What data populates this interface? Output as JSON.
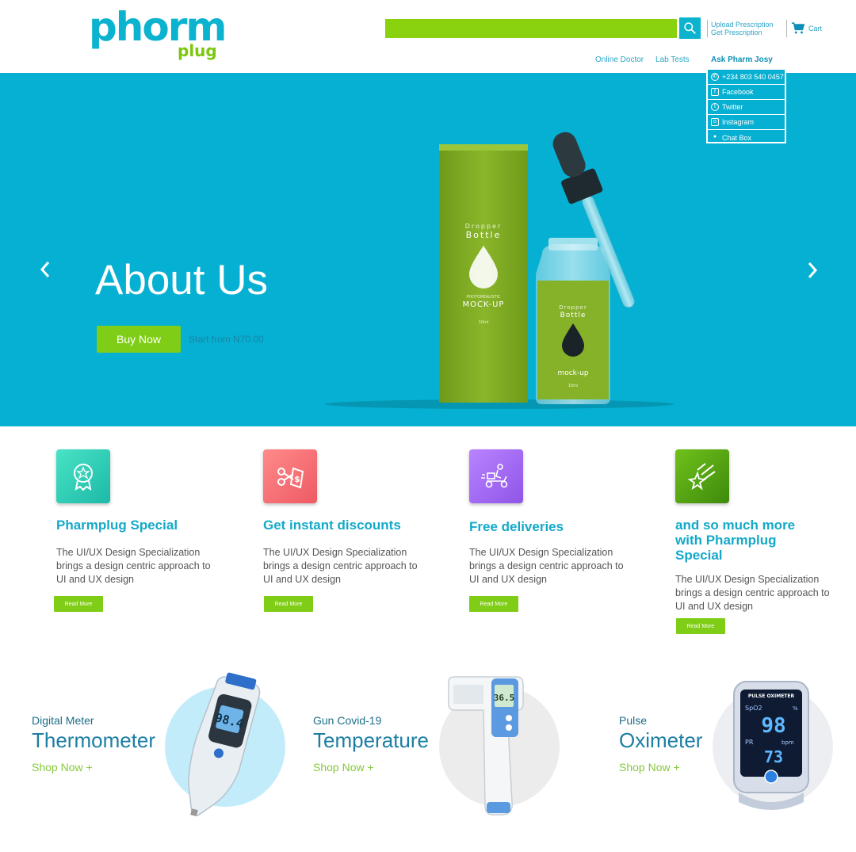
{
  "header": {
    "logo_main": "phorm",
    "logo_sub": "plug",
    "search_placeholder": "",
    "upload_prescription": "Upload Prescription",
    "get_prescription": "Get Prescription",
    "cart_label": "Cart",
    "nav": {
      "online_doctor": "Online Doctor",
      "lab_tests": "Lab Tests",
      "ask": "Ask Pharm Josy"
    }
  },
  "social_menu": [
    {
      "label": "+234 803 540 0457",
      "icon": "phone-icon"
    },
    {
      "label": "Facebook",
      "icon": "facebook-icon"
    },
    {
      "label": "Twitter",
      "icon": "twitter-icon"
    },
    {
      "label": "Instagram",
      "icon": "instagram-icon"
    },
    {
      "label": "Chat Box",
      "icon": "chat-icon"
    }
  ],
  "hero": {
    "title": "About Us",
    "buy_label": "Buy Now",
    "start_text": "Start from N70.00",
    "box_label_1": "Dropper",
    "box_label_2": "Bottle",
    "box_small": "PHOTOREALISTIC",
    "box_mockup": "MOCK-UP",
    "box_ml": "10ml",
    "bottle_label_1": "Dropper",
    "bottle_label_2": "Bottle",
    "bottle_mockup": "mock-up",
    "bottle_ml": "10ml"
  },
  "features": [
    {
      "title": "Pharmplug Special",
      "desc": "The UI/UX Design Specialization brings a design centric approach to UI and UX design",
      "button": "Read More",
      "icon": "award-icon",
      "color": "#2fd4b8"
    },
    {
      "title": "Get instant discounts",
      "desc": "The UI/UX Design Specialization brings a design centric approach to UI and UX design",
      "button": "Read More",
      "icon": "discount-tag-icon",
      "color": "#f36a6e"
    },
    {
      "title": "Free deliveries",
      "desc": "The UI/UX Design Specialization brings a design centric approach to UI and UX design",
      "button": "Read More",
      "icon": "delivery-scooter-icon",
      "color": "#a86af0"
    },
    {
      "title": "and so much more with Pharmplug Special",
      "desc": "The UI/UX Design Specialization brings a design centric approach to UI and UX design",
      "button": "Read More",
      "icon": "shooting-star-icon",
      "color": "#5fae12"
    }
  ],
  "products": [
    {
      "subtitle": "Digital Meter",
      "title": "Thermometer",
      "shop": "Shop Now +",
      "screen": "98.4",
      "icon": "thermometer-icon"
    },
    {
      "subtitle": "Gun Covid-19",
      "title": "Temperature",
      "shop": "Shop Now +",
      "screen": "36.5",
      "icon": "temperature-gun-icon"
    },
    {
      "subtitle": "Pulse",
      "title": "Oximeter",
      "shop": "Shop Now +",
      "screen_title": "PULSE OXIMETER",
      "spo2_label": "SpO2",
      "percent": "%",
      "spo2": "98",
      "pr_label": "PR",
      "bpm": "bpm",
      "pr": "73",
      "icon": "pulse-oximeter-icon"
    }
  ],
  "colors": {
    "brand_blue": "#0bb3cf",
    "brand_green": "#80cd17",
    "hero_bg": "#06b0d2"
  }
}
